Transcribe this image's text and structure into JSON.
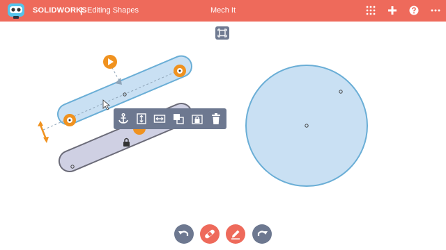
{
  "header": {
    "brand": "SOLIDWORKS",
    "separator": "|",
    "section": "Editing Shapes",
    "document_title": "Mech It",
    "icons": [
      "grid-apps-icon",
      "plus-icon",
      "help-icon",
      "more-icon"
    ]
  },
  "colors": {
    "header_bg": "#ee6a5b",
    "shape_fill": "#c9e0f3",
    "shape_stroke": "#6aaed6",
    "link_fill": "#cfd0e3",
    "link_stroke": "#6b6b78",
    "accent_orange": "#f0921f",
    "toolbar_bg": "#6d7890"
  },
  "context_toolbar": {
    "tools": [
      "anchor-icon",
      "vertical-size-icon",
      "horizontal-size-icon",
      "duplicate-icon",
      "lock-icon",
      "delete-icon"
    ]
  },
  "bottom_toolbar": {
    "buttons": [
      "undo-icon",
      "bandage-icon",
      "pencil-icon",
      "redo-icon"
    ]
  }
}
